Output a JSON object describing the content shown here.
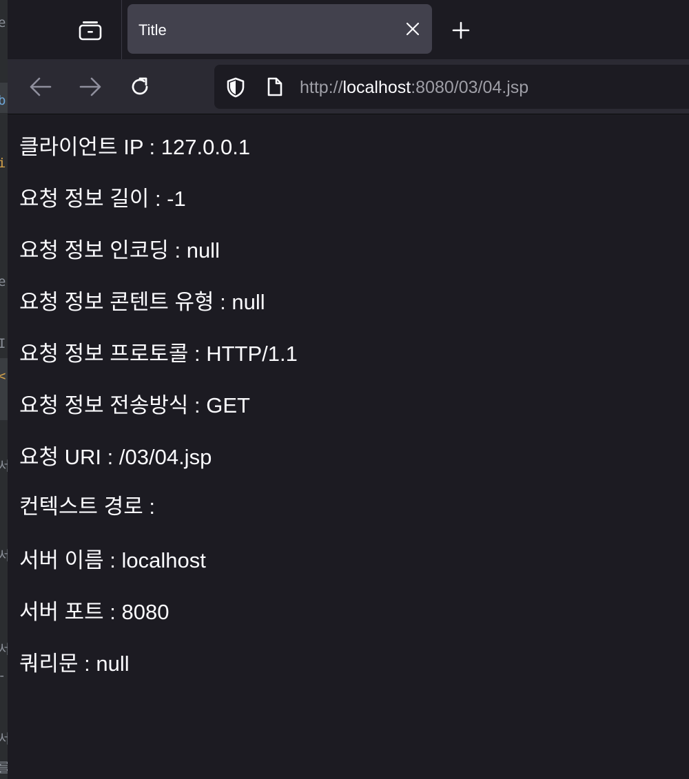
{
  "browser": {
    "tab": {
      "title": "Title"
    },
    "url": {
      "scheme": "http://",
      "host": "localhost",
      "rest": ":8080/03/04.jsp"
    }
  },
  "background_ide": {
    "fragments": [
      "e",
      "b",
      "i",
      "e",
      "I",
      "<",
      "서",
      "서",
      "서",
      "-",
      "서",
      "를"
    ]
  },
  "page": {
    "lines": [
      "클라이언트 IP : 127.0.0.1",
      "요청 정보 길이 : -1",
      "요청 정보 인코딩 : null",
      "요청 정보 콘텐트 유형 : null",
      "요청 정보 프로토콜 : HTTP/1.1",
      "요청 정보 전송방식 : GET",
      "요청 URI : /03/04.jsp",
      "컨텍스트 경로 :",
      "서버 이름 : localhost",
      "서버 포트 : 8080",
      "쿼리문 : null"
    ]
  }
}
